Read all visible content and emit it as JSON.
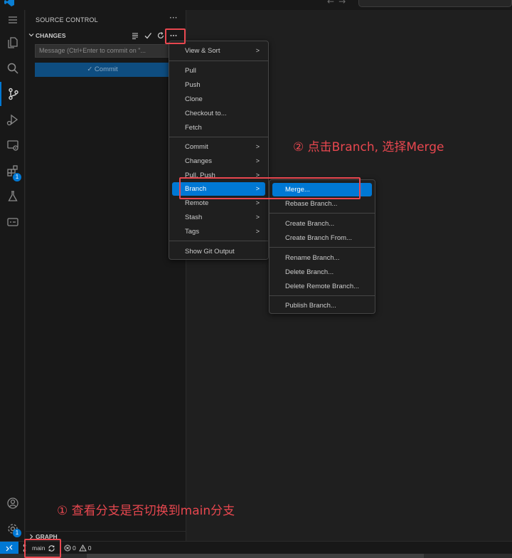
{
  "sidebar": {
    "title": "SOURCE CONTROL",
    "more": "···",
    "changes_label": "CHANGES",
    "message_placeholder": "Message (Ctrl+Enter to commit on \"...",
    "commit_label": "✓ Commit",
    "graph_label": "GRAPH"
  },
  "activity_badges": {
    "extensions": "1",
    "accounts": "1"
  },
  "scm_menu": {
    "items": [
      {
        "label": "View & Sort",
        "submenu": true
      },
      {
        "label": "Pull"
      },
      {
        "label": "Push"
      },
      {
        "label": "Clone"
      },
      {
        "label": "Checkout to..."
      },
      {
        "label": "Fetch"
      },
      {
        "label": "Commit",
        "submenu": true
      },
      {
        "label": "Changes",
        "submenu": true
      },
      {
        "label": "Pull, Push",
        "submenu": true
      },
      {
        "label": "Branch",
        "submenu": true,
        "highlighted": true
      },
      {
        "label": "Remote",
        "submenu": true
      },
      {
        "label": "Stash",
        "submenu": true
      },
      {
        "label": "Tags",
        "submenu": true
      },
      {
        "label": "Show Git Output"
      }
    ]
  },
  "branch_menu": {
    "items": [
      {
        "label": "Merge...",
        "highlighted": true
      },
      {
        "label": "Rebase Branch..."
      },
      {
        "label": "Create Branch..."
      },
      {
        "label": "Create Branch From..."
      },
      {
        "label": "Rename Branch..."
      },
      {
        "label": "Delete Branch..."
      },
      {
        "label": "Delete Remote Branch..."
      },
      {
        "label": "Publish Branch..."
      }
    ]
  },
  "statusbar": {
    "branch": "main",
    "errors": "0",
    "warnings": "0"
  },
  "annotations": {
    "step1": "① 查看分支是否切换到main分支",
    "step2": "② 点击Branch, 选择Merge"
  },
  "colors": {
    "accent": "#0078d4",
    "annotation": "#e8474f"
  }
}
